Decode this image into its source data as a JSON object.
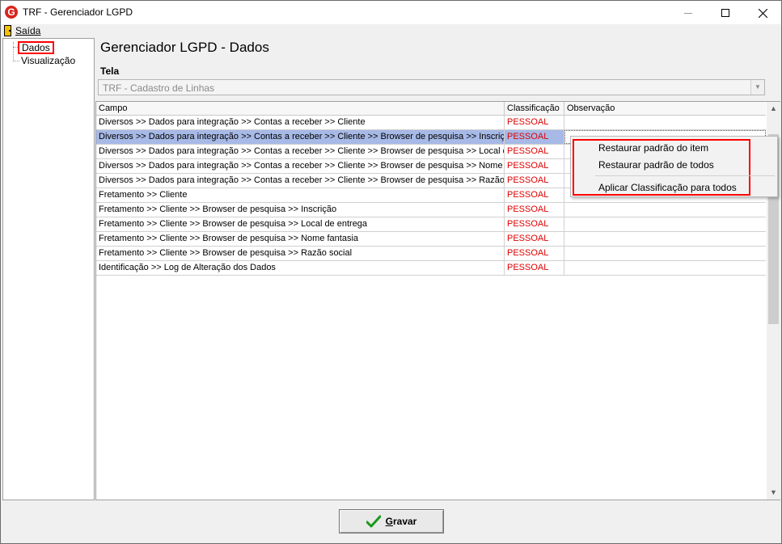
{
  "window": {
    "title": "TRF - Gerenciador LGPD",
    "icon_letter": "G"
  },
  "menu": {
    "saida_label": "Saída"
  },
  "tree": {
    "items": [
      {
        "label": "Dados"
      },
      {
        "label": "Visualização"
      }
    ]
  },
  "main": {
    "title": "Gerenciador LGPD - Dados",
    "tela_label": "Tela",
    "tela_value": "TRF - Cadastro de Linhas"
  },
  "grid": {
    "columns": [
      "Campo",
      "Classificação",
      "Observação"
    ],
    "rows": [
      {
        "campo": "Diversos >> Dados para integração >> Contas a receber >> Cliente",
        "classificacao": "PESSOAL",
        "observacao": ""
      },
      {
        "campo": "Diversos >> Dados para integração >> Contas a receber >> Cliente >> Browser de pesquisa >> Inscrição",
        "classificacao": "PESSOAL",
        "observacao": ""
      },
      {
        "campo": "Diversos >> Dados para integração >> Contas a receber >> Cliente >> Browser de pesquisa >> Local de...",
        "classificacao": "PESSOAL",
        "observacao": ""
      },
      {
        "campo": "Diversos >> Dados para integração >> Contas a receber >> Cliente >> Browser de pesquisa >> Nome fa...",
        "classificacao": "PESSOAL",
        "observacao": ""
      },
      {
        "campo": "Diversos >> Dados para integração >> Contas a receber >> Cliente >> Browser de pesquisa >> Razão s...",
        "classificacao": "PESSOAL",
        "observacao": ""
      },
      {
        "campo": "Fretamento >> Cliente",
        "classificacao": "PESSOAL",
        "observacao": ""
      },
      {
        "campo": "Fretamento >> Cliente >> Browser de pesquisa >> Inscrição",
        "classificacao": "PESSOAL",
        "observacao": ""
      },
      {
        "campo": "Fretamento >> Cliente >> Browser de pesquisa >> Local de entrega",
        "classificacao": "PESSOAL",
        "observacao": ""
      },
      {
        "campo": "Fretamento >> Cliente >> Browser de pesquisa >> Nome fantasia",
        "classificacao": "PESSOAL",
        "observacao": ""
      },
      {
        "campo": "Fretamento >> Cliente >> Browser de pesquisa >> Razão social",
        "classificacao": "PESSOAL",
        "observacao": ""
      },
      {
        "campo": "Identificação >> Log de Alteração dos Dados",
        "classificacao": "PESSOAL",
        "observacao": ""
      }
    ],
    "selected_row_index": 1
  },
  "context_menu": {
    "items": [
      {
        "label": "Restaurar padrão do item"
      },
      {
        "label": "Restaurar padrão de todos"
      },
      {
        "label": "Aplicar Classificação para todos"
      }
    ]
  },
  "footer": {
    "gravar_label_underlined": "G",
    "gravar_label_rest": "ravar"
  },
  "colors": {
    "classification_text": "#e00000",
    "selection_bg": "#a7b9e6",
    "highlight_box": "#ff0000",
    "check_icon": "#1a9a1a"
  },
  "icons": {
    "app": "app-logo-icon",
    "exit": "door-icon",
    "save": "check-icon"
  }
}
